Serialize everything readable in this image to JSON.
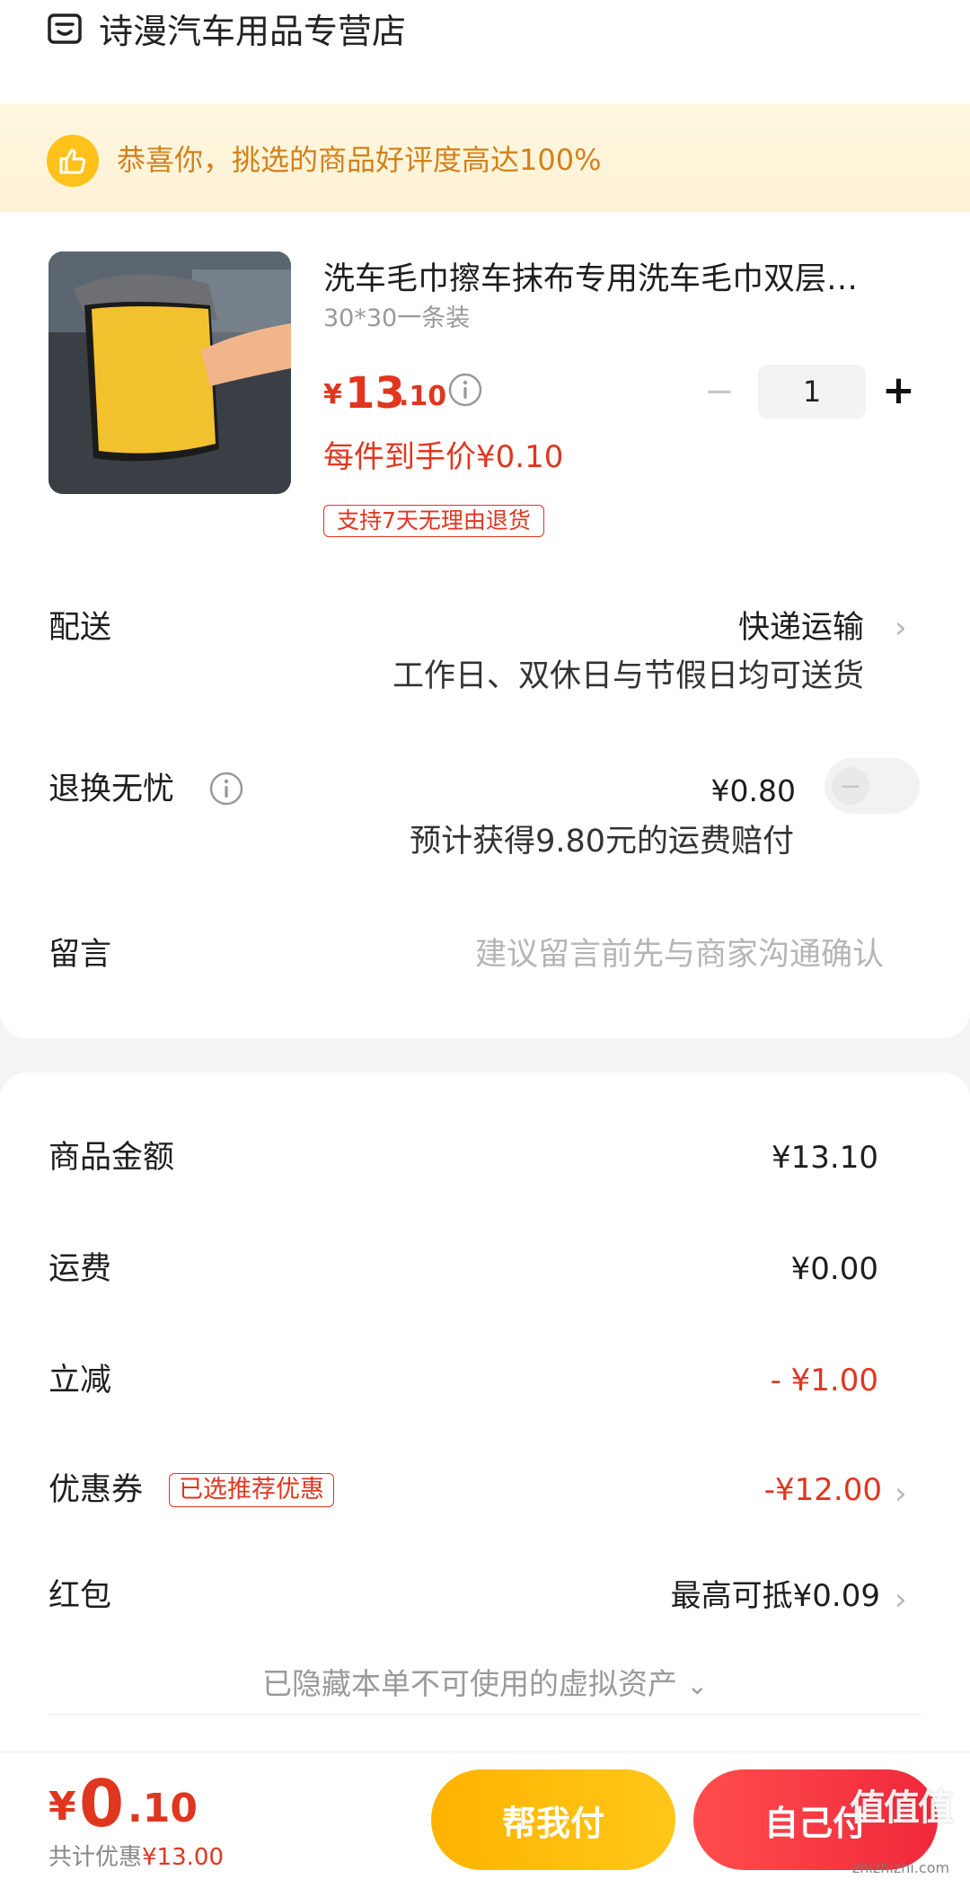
{
  "shop": {
    "name": "诗漫汽车用品专营店"
  },
  "banner": {
    "text": "恭喜你，挑选的商品好评度高达100%"
  },
  "product": {
    "title": "洗车毛巾擦车抹布专用洗车毛巾双层…",
    "sku": "30*30一条装",
    "price_symbol": "¥",
    "price_int": "13",
    "price_dec": ".10",
    "unit_price": "每件到手价¥0.10",
    "return_policy": "支持7天无理由退货",
    "quantity": "1",
    "minus": "−",
    "plus": "+"
  },
  "delivery": {
    "label": "配送",
    "value": "快递运输",
    "sub": "工作日、双休日与节假日均可送货"
  },
  "return_insurance": {
    "label": "退换无忧",
    "value": "¥0.80",
    "sub": "预计获得9.80元的运费赔付",
    "enabled": false
  },
  "message": {
    "label": "留言",
    "placeholder": "建议留言前先与商家沟通确认"
  },
  "summary": {
    "goods_label": "商品金额",
    "goods_value": "¥13.10",
    "shipping_label": "运费",
    "shipping_value": "¥0.00",
    "instant_label": "立减",
    "instant_value": "- ¥1.00",
    "coupon_label": "优惠券",
    "coupon_tag": "已选推荐优惠",
    "coupon_value": "-¥12.00",
    "redpacket_label": "红包",
    "redpacket_value": "最高可抵¥0.09",
    "hidden_assets": "已隐藏本单不可使用的虚拟资产"
  },
  "footer": {
    "total_symbol": "¥",
    "total_int": "0",
    "total_dec": ".10",
    "discount_label": "共计优惠",
    "discount_value": "¥13.00",
    "help_pay": "帮我付",
    "self_pay": "自己付"
  },
  "watermark": {
    "logo": "值值值",
    "url": "zhizhizhi.com"
  },
  "colors": {
    "accent_red": "#e0361f",
    "banner_text": "#d2811a",
    "help_btn": "#ffb300",
    "self_btn": "#f0283a"
  }
}
